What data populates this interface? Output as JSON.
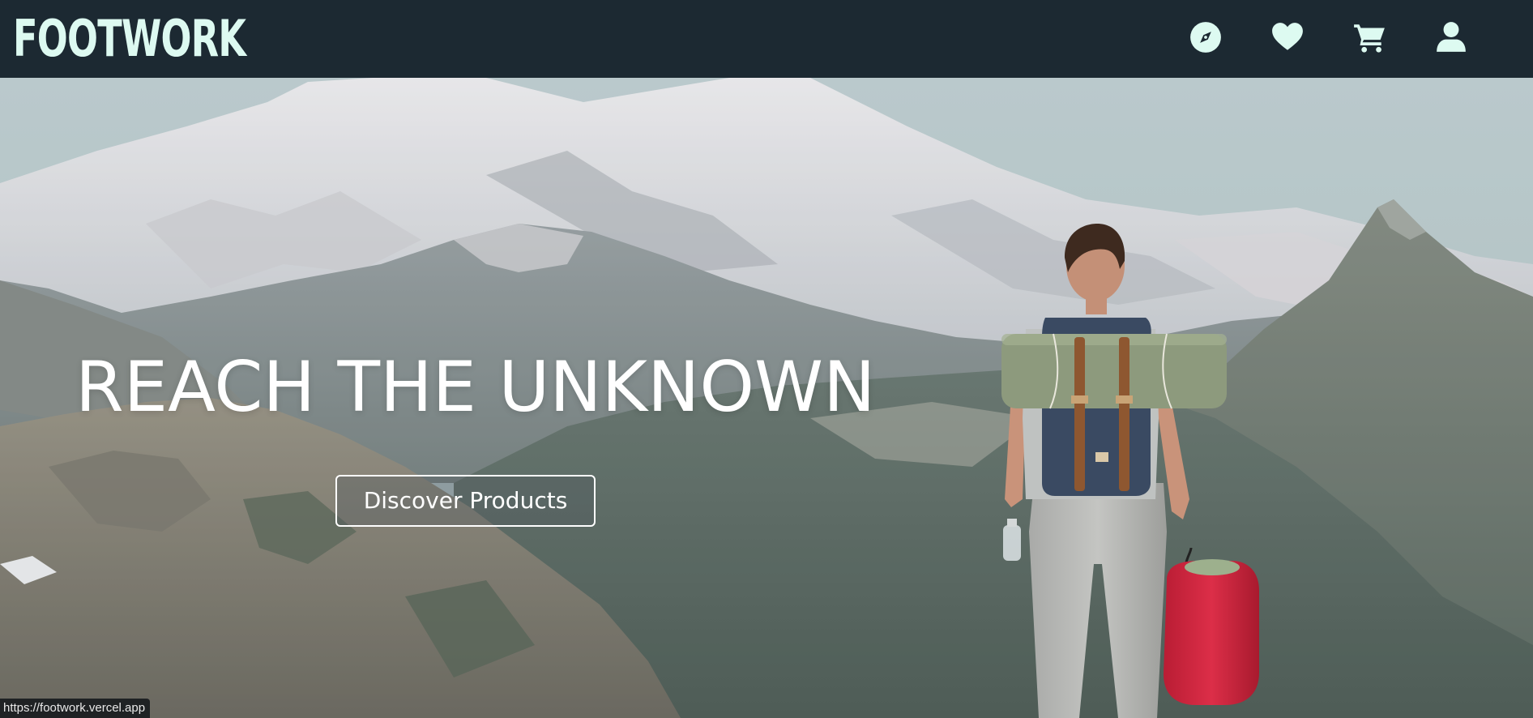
{
  "brand": {
    "logo_text": "FOOTWORK",
    "logo_color": "#ddfaf1",
    "navbar_color": "#1c2932"
  },
  "nav": {
    "icons": [
      {
        "name": "compass-icon",
        "label": "Explore"
      },
      {
        "name": "heart-icon",
        "label": "Favorites"
      },
      {
        "name": "cart-icon",
        "label": "Cart"
      },
      {
        "name": "user-icon",
        "label": "Account"
      }
    ]
  },
  "hero": {
    "title": "REACH THE UNKNOWN",
    "cta_label": "Discover Products",
    "text_color": "#ffffff"
  },
  "status_bar": {
    "url": "https://footwork.vercel.app"
  }
}
